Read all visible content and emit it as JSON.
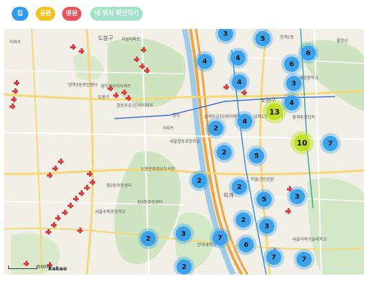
{
  "filters": [
    {
      "key": "home",
      "label": "집",
      "color": "#2f9bf0"
    },
    {
      "key": "park",
      "label": "공원",
      "color": "#f6c21c"
    },
    {
      "key": "hospital",
      "label": "병원",
      "color": "#f0525a"
    },
    {
      "key": "my_location",
      "label": "내 위치 확인하기",
      "color": "#a3e4c8"
    }
  ],
  "map": {
    "scale_label": "500m",
    "provider_logo": "kakao",
    "clusters": [
      {
        "count": "3"
      },
      {
        "count": "5"
      },
      {
        "count": "6"
      },
      {
        "count": "4"
      },
      {
        "count": "4"
      },
      {
        "count": "6"
      },
      {
        "count": "3"
      },
      {
        "count": "4"
      },
      {
        "count": "13"
      },
      {
        "count": "4"
      },
      {
        "count": "2"
      },
      {
        "count": "10"
      },
      {
        "count": "7"
      },
      {
        "count": "2"
      },
      {
        "count": "5"
      },
      {
        "count": "4"
      },
      {
        "count": "2"
      },
      {
        "count": "2"
      },
      {
        "count": "5"
      },
      {
        "count": "3"
      },
      {
        "count": "2"
      },
      {
        "count": "3"
      },
      {
        "count": "2"
      },
      {
        "count": "3"
      },
      {
        "count": "7"
      },
      {
        "count": "6"
      },
      {
        "count": "7"
      },
      {
        "count": "7"
      },
      {
        "count": "2"
      }
    ],
    "labels": [
      "아파트",
      "도봉구",
      "거성아파트",
      "창동",
      "도봉구",
      "아파트",
      "서울창동초등학교",
      "방학3동주민센터",
      "삼익세라믹아파트",
      "창동주공1단지아파트",
      "도봉문화정보도서관",
      "창2동주민센터",
      "창3동주민센터",
      "노원구",
      "상계주공5단지아파트",
      "중계주공단지",
      "서울수락초등학교",
      "인덕대학교",
      "서울과학기술대학교",
      "하계",
      "상계1동주민센터",
      "마들근린공원",
      "재현중학교",
      "청계1동",
      "불암산"
    ],
    "hospitals_count": 35
  }
}
